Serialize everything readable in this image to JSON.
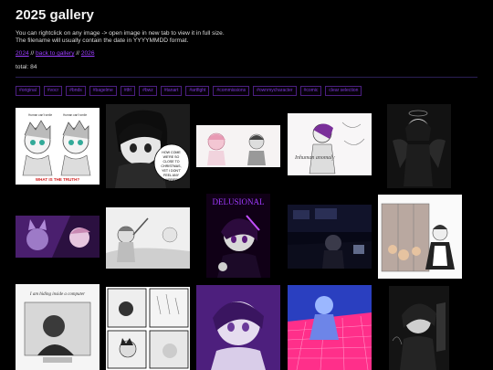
{
  "page": {
    "title": "2025 gallery",
    "intro_line1": "You can rightclick on any image -> open image in new tab to view it in full size.",
    "intro_line2": "The filename will usually contain the date in YYYYMMDD format.",
    "nav": {
      "prev": "2024",
      "sep1": " // ",
      "back": "back to gallery",
      "sep2": " // ",
      "next": "2026"
    },
    "total": "total: 84"
  },
  "tags": [
    "#original",
    "#vocr",
    "#bnds",
    "#bagelme",
    "#tfrl",
    "#bwz",
    "#tanart",
    "#artfight",
    "#commissions",
    "#ownmycharacter",
    "#comic",
    "clear selection"
  ],
  "thumbs": [
    {
      "name": "thumb-truth-comic",
      "caption_top_left": "Human can't smile",
      "caption_top_right": "Human can't smile",
      "caption": "WHAT IS THE TRUTH?"
    },
    {
      "name": "thumb-christmas-speech",
      "speech": "HOW COME WE'RE SO CLOSE TO CHRISTMAS YET I DON'T FEEL ANY HAPPIER?"
    },
    {
      "name": "thumb-pink-sketch"
    },
    {
      "name": "thumb-sketch-page",
      "scribble": "Inhuman anomaly"
    },
    {
      "name": "thumb-dark-winged"
    },
    {
      "name": "thumb-purple-cat"
    },
    {
      "name": "thumb-grey-wave"
    },
    {
      "name": "thumb-delusional",
      "title_text": "DELUSIONAL"
    },
    {
      "name": "thumb-dark-street"
    },
    {
      "name": "thumb-maid-lockers"
    },
    {
      "name": "thumb-inside-computer",
      "caption": "I am hiding inside a computer"
    },
    {
      "name": "thumb-four-panel-comic"
    },
    {
      "name": "thumb-purple-portrait"
    },
    {
      "name": "thumb-neon-grid"
    },
    {
      "name": "thumb-dark-poster"
    }
  ]
}
